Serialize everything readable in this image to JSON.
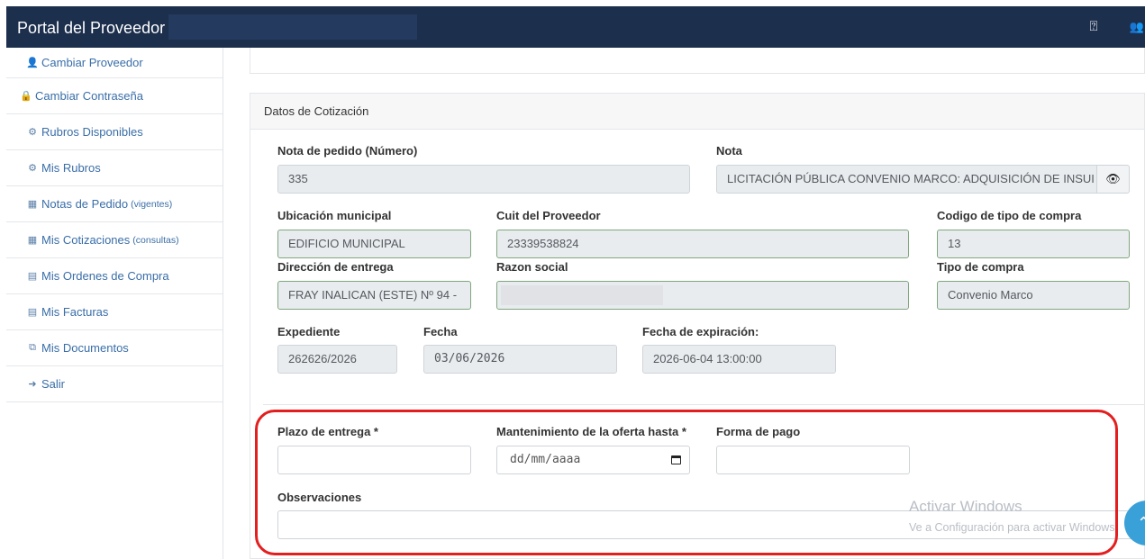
{
  "app": {
    "title": "Portal del Proveedor",
    "icons": {
      "help": "question-circle-icon",
      "users": "users-icon"
    },
    "colors": {
      "topbar": "#1c2f4d",
      "link": "#3a6ea8",
      "highlight": "#e41e1e"
    }
  },
  "sidebar": {
    "items": [
      {
        "icon": "user-icon",
        "glyph": "👤",
        "label": "Cambiar Proveedor",
        "sub": ""
      },
      {
        "icon": "lock-icon",
        "glyph": "🔒",
        "label": "Cambiar Contraseña",
        "sub": ""
      },
      {
        "icon": "cogs-icon",
        "glyph": "⚙",
        "label": "Rubros Disponibles",
        "sub": ""
      },
      {
        "icon": "cogs-icon",
        "glyph": "⚙",
        "label": "Mis Rubros",
        "sub": ""
      },
      {
        "icon": "table-icon",
        "glyph": "▦",
        "label": "Notas de Pedido",
        "sub": "(vigentes)"
      },
      {
        "icon": "table-icon",
        "glyph": "▦",
        "label": "Mis Cotizaciones",
        "sub": "(consultas)"
      },
      {
        "icon": "file-text-icon",
        "glyph": "▤",
        "label": "Mis Ordenes de Compra",
        "sub": ""
      },
      {
        "icon": "file-text-icon",
        "glyph": "▤",
        "label": "Mis Facturas",
        "sub": ""
      },
      {
        "icon": "copy-icon",
        "glyph": "⧉",
        "label": "Mis Documentos",
        "sub": ""
      },
      {
        "icon": "sign-out-icon",
        "glyph": "➜",
        "label": "Salir",
        "sub": ""
      }
    ]
  },
  "quote": {
    "header": "Datos de Cotización",
    "nota_pedido": {
      "label": "Nota de pedido (Número)",
      "value": "335"
    },
    "nota": {
      "label": "Nota",
      "value": "LICITACIÓN PÚBLICA CONVENIO MARCO: ADQUISICIÓN DE INSUI",
      "icon": "eye-icon"
    },
    "ubicacion": {
      "label": "Ubicación municipal",
      "value": "EDIFICIO MUNICIPAL"
    },
    "cuit": {
      "label": "Cuit del Proveedor",
      "value": "23339538824"
    },
    "codigo_tipo": {
      "label": "Codigo de tipo de compra",
      "value": "13"
    },
    "direccion": {
      "label": "Dirección de entrega",
      "value": "FRAY INALICAN (ESTE) Nº 94 -"
    },
    "razon_social": {
      "label": "Razon social",
      "value": ""
    },
    "tipo_compra": {
      "label": "Tipo de compra",
      "value": "Convenio Marco"
    },
    "expediente": {
      "label": "Expediente",
      "value": "262626/2026"
    },
    "fecha": {
      "label": "Fecha",
      "value": "03/06/2026"
    },
    "fecha_exp": {
      "label": "Fecha de expiración:",
      "value": "2026-06-04 13:00:00"
    }
  },
  "offer": {
    "plazo": {
      "label": "Plazo de entrega *",
      "value": ""
    },
    "mantenimiento": {
      "label": "Mantenimiento de la oferta hasta *",
      "placeholder": "dd/mm/aaaa",
      "icon": "calendar-icon"
    },
    "forma_pago": {
      "label": "Forma de pago",
      "value": ""
    },
    "observaciones": {
      "label": "Observaciones",
      "value": ""
    }
  },
  "watermark": {
    "line1": "Activar Windows",
    "line2": "Ve a Configuración para activar Windows."
  }
}
